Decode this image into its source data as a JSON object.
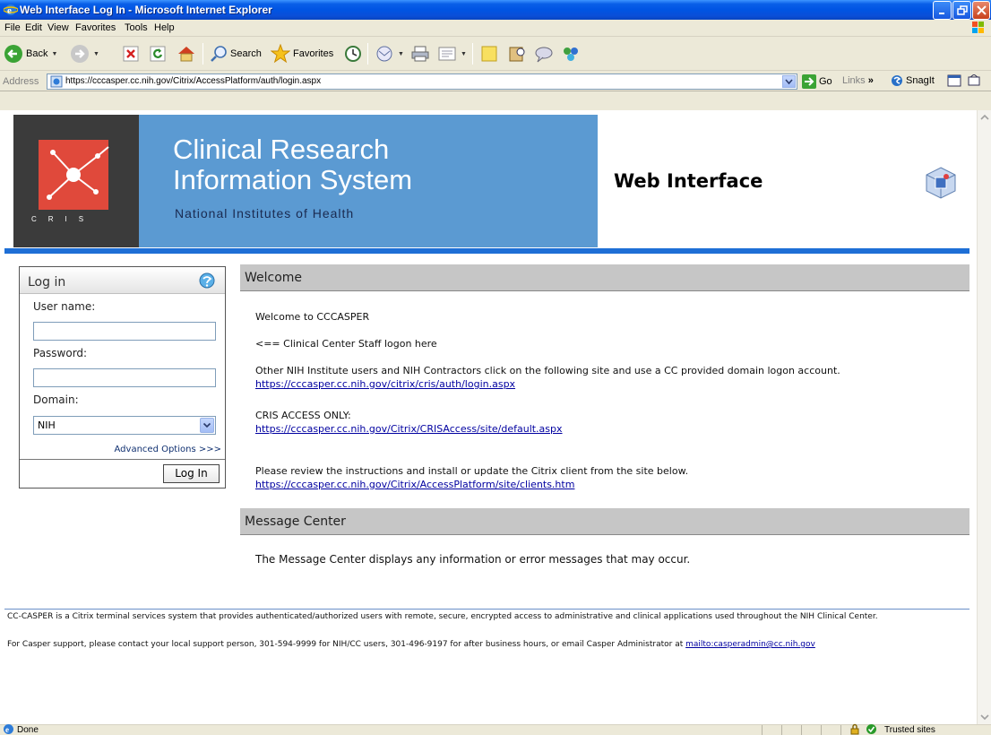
{
  "window": {
    "title": "Web Interface Log In - Microsoft Internet Explorer"
  },
  "menu": [
    "File",
    "Edit",
    "View",
    "Favorites",
    "Tools",
    "Help"
  ],
  "toolbar": {
    "back_label": "Back",
    "search_label": "Search",
    "favorites_label": "Favorites"
  },
  "address": {
    "label": "Address",
    "url": "https://cccasper.cc.nih.gov/Citrix/AccessPlatform/auth/login.aspx",
    "go_label": "Go",
    "links_label": "Links",
    "snagit_label": "SnagIt"
  },
  "banner": {
    "logo_letters": "CRIS",
    "title_line1": "Clinical Research",
    "title_line2": "Information System",
    "subtitle": "National Institutes of Health",
    "web_interface": "Web Interface"
  },
  "login": {
    "title": "Log in",
    "username_label": "User name:",
    "username_value": "",
    "password_label": "Password:",
    "password_value": "",
    "domain_label": "Domain:",
    "domain_value": "NIH",
    "advanced_options": "Advanced Options >>>",
    "login_button": "Log In"
  },
  "welcome": {
    "header": "Welcome",
    "line1": "Welcome to CCCASPER",
    "line2": "<== Clinical Center Staff logon here",
    "line3": "Other NIH Institute users and NIH Contractors click on the following site and use a CC provided domain logon account.",
    "link1": "https://cccasper.cc.nih.gov/citrix/cris/auth/login.aspx",
    "line4": "CRIS ACCESS ONLY:",
    "link2": "https://cccasper.cc.nih.gov/Citrix/CRISAccess/site/default.aspx",
    "line5": "Please review the instructions and install or update the Citrix client from the site below.",
    "link3": "https://cccasper.cc.nih.gov/Citrix/AccessPlatform/site/clients.htm"
  },
  "message_center": {
    "header": "Message Center",
    "text": "The Message Center displays any information or error messages that may occur."
  },
  "footer": {
    "line1": "CC-CASPER is a Citrix terminal services system that provides authenticated/authorized users with remote, secure, encrypted access to administrative and clinical applications used throughout the NIH Clinical Center.",
    "line2": "For Casper support, please contact your local support person, 301-594-9999 for NIH/CC users, 301-496-9197 for after business hours, or email Casper Administrator at",
    "email_link": "mailto:casperadmin@cc.nih.gov"
  },
  "status": {
    "text": "Done",
    "zone": "Trusted sites"
  },
  "colors": {
    "banner_blue": "#5B9AD2",
    "logo_red": "#E0493B",
    "divider_blue": "#1E6FD6",
    "xp_title": "#0054E3"
  }
}
